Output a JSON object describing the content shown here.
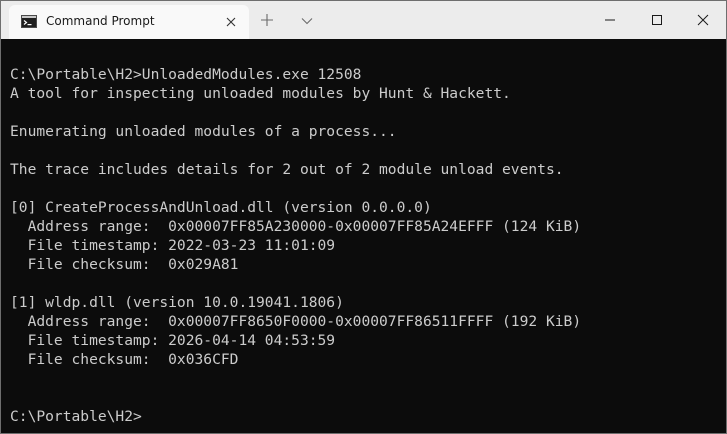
{
  "window": {
    "tab_title": "Command Prompt",
    "tab_icon": "command-prompt-icon",
    "buttons": {
      "close_tab": "close-icon",
      "new_tab": "plus-icon",
      "tab_dropdown": "chevron-down-icon",
      "minimize": "minimize-icon",
      "maximize": "maximize-icon",
      "close_window": "close-icon"
    }
  },
  "colors": {
    "terminal_background": "#0c0c0c",
    "terminal_text": "#cccccc",
    "titlebar_background": "#ececec",
    "active_tab_background": "#f9f9f9"
  },
  "terminal": {
    "lines": [
      "",
      "C:\\Portable\\H2>UnloadedModules.exe 12508",
      "A tool for inspecting unloaded modules by Hunt & Hackett.",
      "",
      "Enumerating unloaded modules of a process...",
      "",
      "The trace includes details for 2 out of 2 module unload events.",
      "",
      "[0] CreateProcessAndUnload.dll (version 0.0.0.0)",
      "  Address range:  0x00007FF85A230000-0x00007FF85A24EFFF (124 KiB)",
      "  File timestamp: 2022-03-23 11:01:09",
      "  File checksum:  0x029A81",
      "",
      "[1] wldp.dll (version 10.0.19041.1806)",
      "  Address range:  0x00007FF8650F0000-0x00007FF86511FFFF (192 KiB)",
      "  File timestamp: 2026-04-14 04:53:59",
      "  File checksum:  0x036CFD",
      "",
      "",
      "C:\\Portable\\H2>"
    ]
  }
}
